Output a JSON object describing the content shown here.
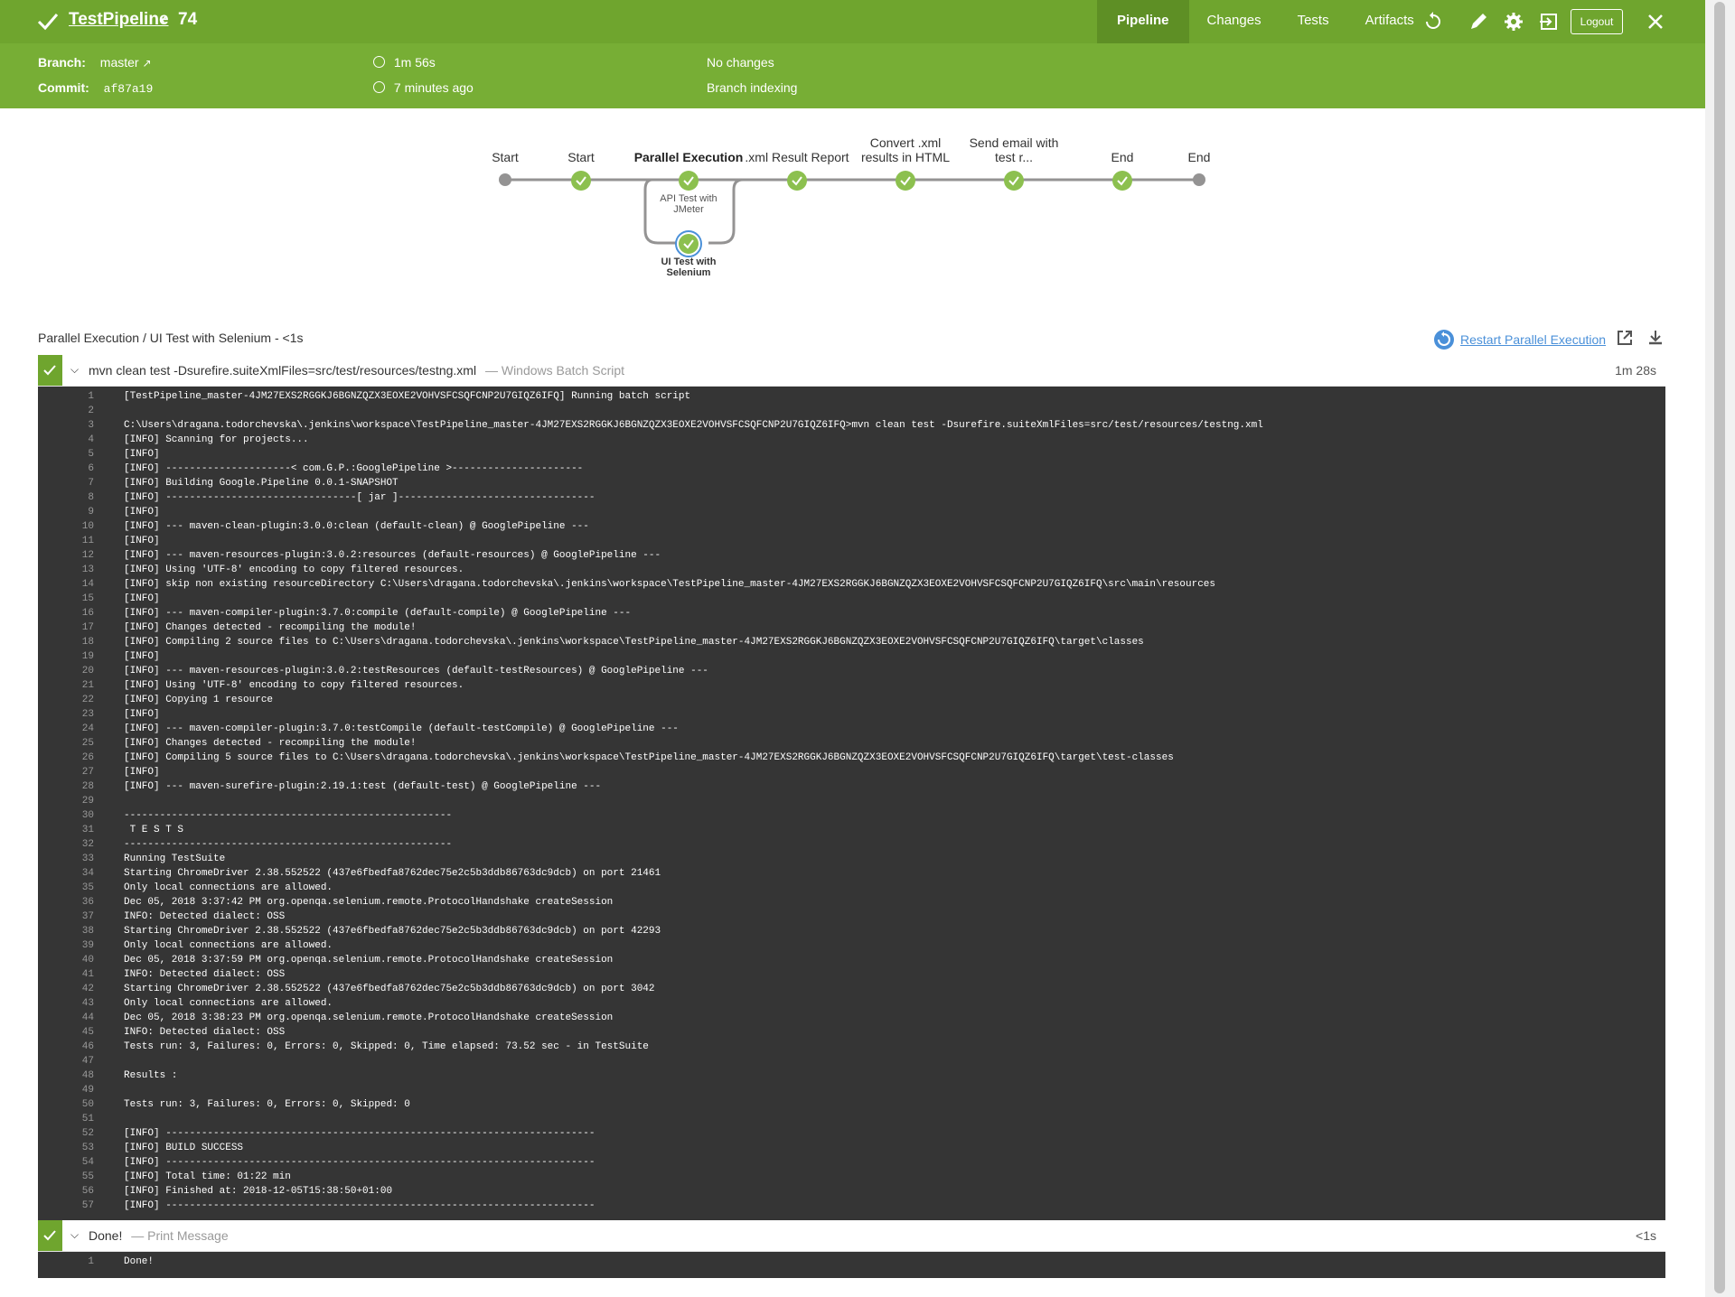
{
  "header": {
    "pipeline_name": "TestPipeline",
    "run_number": "74",
    "tabs": [
      {
        "label": "Pipeline",
        "active": true
      },
      {
        "label": "Changes",
        "active": false
      },
      {
        "label": "Tests",
        "active": false
      },
      {
        "label": "Artifacts",
        "active": false
      }
    ],
    "logout_label": "Logout",
    "icons": [
      "replay-icon",
      "edit-icon",
      "gear-icon",
      "exit-icon",
      "close-icon"
    ]
  },
  "summary": {
    "branch_label": "Branch:",
    "branch_value": "master",
    "commit_label": "Commit:",
    "commit_value": "af87a19",
    "duration": "1m 56s",
    "started": "7 minutes ago",
    "changes": "No changes",
    "cause": "Branch indexing"
  },
  "graph": {
    "stages": [
      {
        "label": "Start",
        "status": "none"
      },
      {
        "label": "Start",
        "status": "success"
      },
      {
        "label": "Parallel Execution",
        "status": "success",
        "parallel": [
          {
            "label": "API Test with JMeter",
            "status": "success"
          },
          {
            "label": "UI Test with Selenium",
            "status": "success",
            "selected": true
          }
        ]
      },
      {
        "label": ".xml Result Report",
        "status": "success"
      },
      {
        "label": "Convert .xml results in HTML",
        "status": "success"
      },
      {
        "label": "Send email with test r...",
        "status": "success"
      },
      {
        "label": "End",
        "status": "success"
      },
      {
        "label": "End",
        "status": "none"
      }
    ]
  },
  "detail": {
    "breadcrumb": "Parallel Execution / UI Test with Selenium - <1s",
    "restart_label": "Restart Parallel Execution"
  },
  "steps": [
    {
      "title": "mvn clean test -Dsurefire.suiteXmlFiles=src/test/resources/testng.xml",
      "type": "— Windows Batch Script",
      "duration": "1m 28s",
      "lines": [
        "[TestPipeline_master-4JM27EXS2RGGKJ6BGNZQZX3EOXE2VOHVSFCSQFCNP2U7GIQZ6IFQ] Running batch script",
        "",
        "C:\\Users\\dragana.todorchevska\\.jenkins\\workspace\\TestPipeline_master-4JM27EXS2RGGKJ6BGNZQZX3EOXE2VOHVSFCSQFCNP2U7GIQZ6IFQ>mvn clean test -Dsurefire.suiteXmlFiles=src/test/resources/testng.xml",
        "[INFO] Scanning for projects...",
        "[INFO]",
        "[INFO] ---------------------< com.G.P.:GooglePipeline >----------------------",
        "[INFO] Building Google.Pipeline 0.0.1-SNAPSHOT",
        "[INFO] --------------------------------[ jar ]---------------------------------",
        "[INFO]",
        "[INFO] --- maven-clean-plugin:3.0.0:clean (default-clean) @ GooglePipeline ---",
        "[INFO]",
        "[INFO] --- maven-resources-plugin:3.0.2:resources (default-resources) @ GooglePipeline ---",
        "[INFO] Using 'UTF-8' encoding to copy filtered resources.",
        "[INFO] skip non existing resourceDirectory C:\\Users\\dragana.todorchevska\\.jenkins\\workspace\\TestPipeline_master-4JM27EXS2RGGKJ6BGNZQZX3EOXE2VOHVSFCSQFCNP2U7GIQZ6IFQ\\src\\main\\resources",
        "[INFO]",
        "[INFO] --- maven-compiler-plugin:3.7.0:compile (default-compile) @ GooglePipeline ---",
        "[INFO] Changes detected - recompiling the module!",
        "[INFO] Compiling 2 source files to C:\\Users\\dragana.todorchevska\\.jenkins\\workspace\\TestPipeline_master-4JM27EXS2RGGKJ6BGNZQZX3EOXE2VOHVSFCSQFCNP2U7GIQZ6IFQ\\target\\classes",
        "[INFO]",
        "[INFO] --- maven-resources-plugin:3.0.2:testResources (default-testResources) @ GooglePipeline ---",
        "[INFO] Using 'UTF-8' encoding to copy filtered resources.",
        "[INFO] Copying 1 resource",
        "[INFO]",
        "[INFO] --- maven-compiler-plugin:3.7.0:testCompile (default-testCompile) @ GooglePipeline ---",
        "[INFO] Changes detected - recompiling the module!",
        "[INFO] Compiling 5 source files to C:\\Users\\dragana.todorchevska\\.jenkins\\workspace\\TestPipeline_master-4JM27EXS2RGGKJ6BGNZQZX3EOXE2VOHVSFCSQFCNP2U7GIQZ6IFQ\\target\\test-classes",
        "[INFO]",
        "[INFO] --- maven-surefire-plugin:2.19.1:test (default-test) @ GooglePipeline ---",
        "",
        "-------------------------------------------------------",
        " T E S T S",
        "-------------------------------------------------------",
        "Running TestSuite",
        "Starting ChromeDriver 2.38.552522 (437e6fbedfa8762dec75e2c5b3ddb86763dc9dcb) on port 21461",
        "Only local connections are allowed.",
        "Dec 05, 2018 3:37:42 PM org.openqa.selenium.remote.ProtocolHandshake createSession",
        "INFO: Detected dialect: OSS",
        "Starting ChromeDriver 2.38.552522 (437e6fbedfa8762dec75e2c5b3ddb86763dc9dcb) on port 42293",
        "Only local connections are allowed.",
        "Dec 05, 2018 3:37:59 PM org.openqa.selenium.remote.ProtocolHandshake createSession",
        "INFO: Detected dialect: OSS",
        "Starting ChromeDriver 2.38.552522 (437e6fbedfa8762dec75e2c5b3ddb86763dc9dcb) on port 3042",
        "Only local connections are allowed.",
        "Dec 05, 2018 3:38:23 PM org.openqa.selenium.remote.ProtocolHandshake createSession",
        "INFO: Detected dialect: OSS",
        "Tests run: 3, Failures: 0, Errors: 0, Skipped: 0, Time elapsed: 73.52 sec - in TestSuite",
        "",
        "Results :",
        "",
        "Tests run: 3, Failures: 0, Errors: 0, Skipped: 0",
        "",
        "[INFO] ------------------------------------------------------------------------",
        "[INFO] BUILD SUCCESS",
        "[INFO] ------------------------------------------------------------------------",
        "[INFO] Total time: 01:22 min",
        "[INFO] Finished at: 2018-12-05T15:38:50+01:00",
        "[INFO] ------------------------------------------------------------------------"
      ]
    },
    {
      "title": "Done!",
      "type": "— Print Message",
      "duration": "<1s",
      "lines": [
        "Done!"
      ]
    }
  ],
  "colors": {
    "header_green": "#6fa52e",
    "subheader_green": "#77ae35",
    "success_green": "#8cc04f",
    "log_bg": "#353535",
    "link_blue": "#4a90d9"
  }
}
